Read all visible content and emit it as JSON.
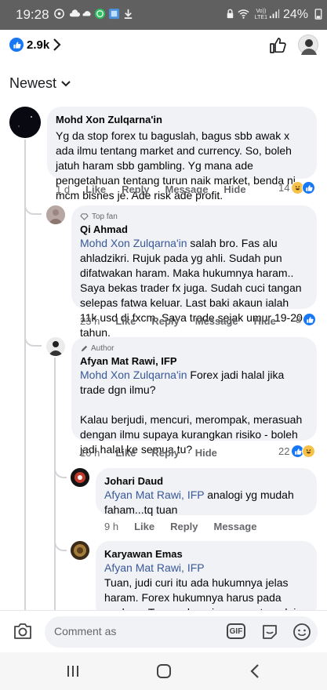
{
  "status_bar": {
    "time": "19:28",
    "volte": "Vo))\nLTE1",
    "battery": "24%"
  },
  "reactions": {
    "count": "2.9k"
  },
  "sort": {
    "label": "Newest"
  },
  "comments": [
    {
      "author": "Mohd Xon Zulqarna'in",
      "text": "Yg da stop forex tu baguslah, bagus sbb awak x ada ilmu tentang market and currency. So, boleh jatuh haram sbb gambling. Yg mana ade pengetahuan tentang turun naik market, benda ni mcm bisnes je. Ade risk ade profit.",
      "time": "1 d",
      "like": "Like",
      "reply": "Reply",
      "message": "Message",
      "hide": "Hide",
      "reaction_count": "14"
    },
    {
      "badge": "Top fan",
      "author": "Qi Ahmad",
      "mention": "Mohd Xon Zulqarna'in",
      "text": " salah bro. Fas alu ahladzikri. Rujuk pada yg ahli. Sudah pun difatwakan haram. Maka hukumnya haram.. Saya bekas trader fx juga. Sudah cuci tangan selepas fatwa keluar. Last baki akaun ialah 11k usd di fxcm. Saya trade sejak umur 19-20 tahun.",
      "time": "23 h",
      "like": "Like",
      "reply": "Reply",
      "message": "Message",
      "hide": "Hide",
      "reaction_count": "8"
    },
    {
      "badge": "Author",
      "author": "Afyan Mat Rawi, IFP",
      "mention": "Mohd Xon Zulqarna'in",
      "text": " Forex jadi halal jika trade dgn ilmu?",
      "text2": "Kalau berjudi, mencuri, merompak, merasuah dengan ilmu supaya kurangkan risiko - boleh jadi halal ke semua tu?",
      "time": "10 h",
      "like": "Like",
      "reply": "Reply",
      "hide": "Hide",
      "reaction_count": "22"
    },
    {
      "author": "Johari Daud",
      "mention": "Afyan Mat Rawi, IFP",
      "text": " analogi yg mudah faham...tq tuan",
      "time": "9 h",
      "like": "Like",
      "reply": "Reply",
      "message": "Message"
    },
    {
      "author": "Karyawan Emas",
      "mention": "Afyan Mat Rawi, IFP",
      "text": "Tuan, judi curi itu ada hukumnya jelas haram. Forex hukumnya harus pada asalnya. Tuan sebagai seorang terpelajar dan terdedah"
    }
  ],
  "composer": {
    "placeholder": "Comment as",
    "gif": "GIF"
  },
  "colors": {
    "accent": "#1877f2",
    "bubble": "#f0f2f5",
    "mention": "#385898",
    "muted": "#65676b"
  }
}
